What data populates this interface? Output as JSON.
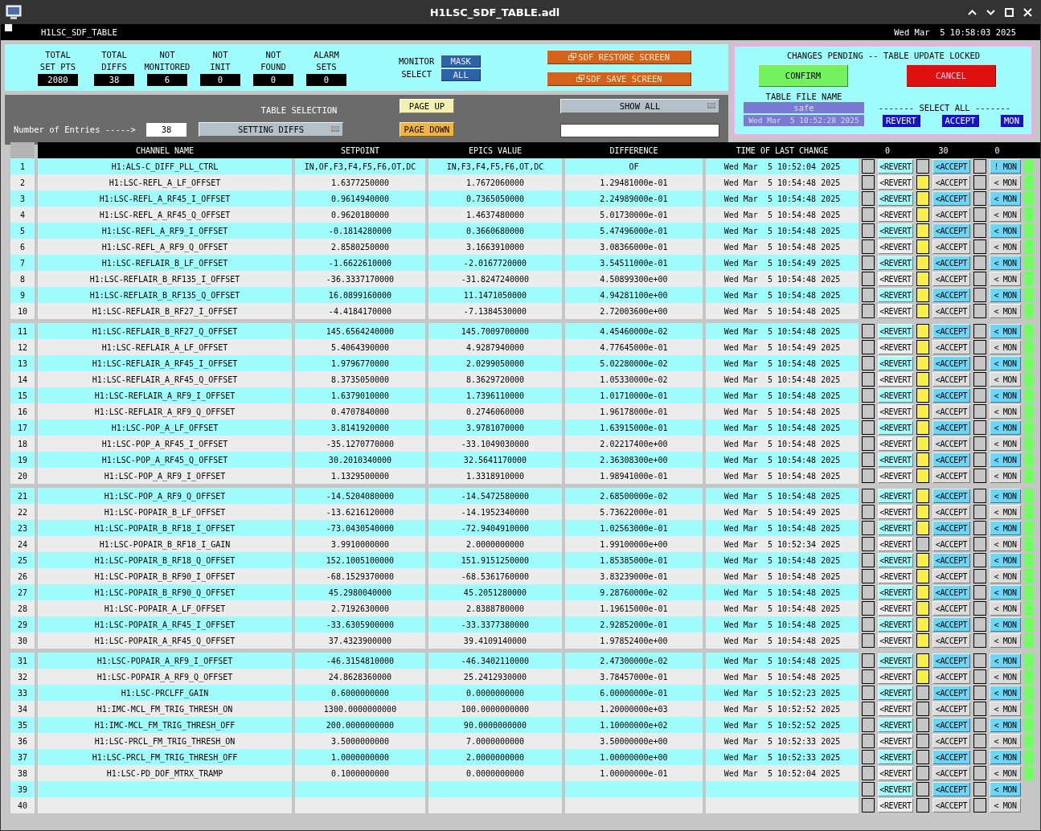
{
  "window": {
    "title": "H1LSC_SDF_TABLE.adl"
  },
  "banner": {
    "name": "H1LSC_SDF_TABLE",
    "datetime": "Wed Mar  5 10:58:03 2025"
  },
  "stats": [
    {
      "label": [
        "TOTAL",
        "SET PTS"
      ],
      "value": "2080"
    },
    {
      "label": [
        "TOTAL",
        "DIFFS"
      ],
      "value": "38"
    },
    {
      "label": [
        "NOT",
        "MONITORED"
      ],
      "value": "6"
    },
    {
      "label": [
        "NOT",
        "INIT"
      ],
      "value": "0"
    },
    {
      "label": [
        "NOT",
        "FOUND"
      ],
      "value": "0"
    },
    {
      "label": [
        "ALARM",
        "SETS"
      ],
      "value": "0"
    }
  ],
  "monitor_select": {
    "label": [
      "MONITOR",
      "SELECT"
    ],
    "options": [
      "MASK",
      "ALL"
    ]
  },
  "screen_buttons": [
    "SDF RESTORE SCREEN",
    "SDF SAVE SCREEN"
  ],
  "selection": {
    "entries_label": "Number of Entries ----->",
    "entries": "38",
    "table_selection_label": "TABLE SELECTION",
    "table_selection": "SETTING DIFFS",
    "page_up": "PAGE UP",
    "page_down": "PAGE DOWN",
    "filter": "SHOW ALL"
  },
  "pending": {
    "message": "CHANGES PENDING -- TABLE UPDATE LOCKED",
    "confirm": "CONFIRM",
    "cancel": "CANCEL",
    "file_label": "TABLE FILE NAME",
    "file_name": "safe",
    "file_time": "Wed Mar  5 10:52:28 2025",
    "select_all_label": "------- SELECT ALL -------",
    "select_all": [
      "REVERT",
      "ACCEPT",
      "MON"
    ]
  },
  "table": {
    "columns": [
      "CHANNEL NAME",
      "SETPOINT",
      "EPICS VALUE",
      "DIFFERENCE",
      "TIME OF LAST CHANGE",
      "0",
      "30",
      "0"
    ],
    "rows": [
      {
        "n": "1",
        "channel": "H1:ALS-C_DIFF_PLL_CTRL",
        "setpoint": "IN,OF,F3,F4,F5,F6,OT,DC",
        "epics": "IN,F3,F4,F5,F6,OT,DC",
        "diff": "OF",
        "time": "Wed Mar  5 10:52:04 2025",
        "revert": false,
        "revert_label": "<REVERT",
        "accept": false,
        "accept_label": "<ACCEPT",
        "mon": false,
        "mon_label": "! MON",
        "indicator": true
      },
      {
        "n": "2",
        "channel": "H1:LSC-REFL_A_LF_OFFSET",
        "setpoint": "1.6377250000",
        "epics": "1.7672060000",
        "diff": "1.29481000e-01",
        "time": "Wed Mar  5 10:54:48 2025",
        "revert": false,
        "revert_label": "<REVERT",
        "accept": true,
        "accept_label": "<ACCEPT",
        "mon": false,
        "mon_label": "< MON",
        "indicator": true
      },
      {
        "n": "3",
        "channel": "H1:LSC-REFL_A_RF45_I_OFFSET",
        "setpoint": "0.9614940000",
        "epics": "0.7365050000",
        "diff": "2.24989000e-01",
        "time": "Wed Mar  5 10:54:48 2025",
        "revert": false,
        "revert_label": "<REVERT",
        "accept": true,
        "accept_label": "<ACCEPT",
        "mon": false,
        "mon_label": "< MON",
        "indicator": true
      },
      {
        "n": "4",
        "channel": "H1:LSC-REFL_A_RF45_Q_OFFSET",
        "setpoint": "0.9620180000",
        "epics": "1.4637480000",
        "diff": "5.01730000e-01",
        "time": "Wed Mar  5 10:54:48 2025",
        "revert": false,
        "revert_label": "<REVERT",
        "accept": true,
        "accept_label": "<ACCEPT",
        "mon": false,
        "mon_label": "< MON",
        "indicator": true
      },
      {
        "n": "5",
        "channel": "H1:LSC-REFL_A_RF9_I_OFFSET",
        "setpoint": "-0.1814280000",
        "epics": "0.3660680000",
        "diff": "5.47496000e-01",
        "time": "Wed Mar  5 10:54:48 2025",
        "revert": false,
        "revert_label": "<REVERT",
        "accept": true,
        "accept_label": "<ACCEPT",
        "mon": false,
        "mon_label": "< MON",
        "indicator": true
      },
      {
        "n": "6",
        "channel": "H1:LSC-REFL_A_RF9_Q_OFFSET",
        "setpoint": "2.8580250000",
        "epics": "3.1663910000",
        "diff": "3.08366000e-01",
        "time": "Wed Mar  5 10:54:48 2025",
        "revert": false,
        "revert_label": "<REVERT",
        "accept": true,
        "accept_label": "<ACCEPT",
        "mon": false,
        "mon_label": "< MON",
        "indicator": true
      },
      {
        "n": "7",
        "channel": "H1:LSC-REFLAIR_B_LF_OFFSET",
        "setpoint": "-1.6622610000",
        "epics": "-2.0167720000",
        "diff": "3.54511000e-01",
        "time": "Wed Mar  5 10:54:49 2025",
        "revert": false,
        "revert_label": "<REVERT",
        "accept": true,
        "accept_label": "<ACCEPT",
        "mon": false,
        "mon_label": "< MON",
        "indicator": true
      },
      {
        "n": "8",
        "channel": "H1:LSC-REFLAIR_B_RF135_I_OFFSET",
        "setpoint": "-36.3337170000",
        "epics": "-31.8247240000",
        "diff": "4.50899300e+00",
        "time": "Wed Mar  5 10:54:48 2025",
        "revert": false,
        "revert_label": "<REVERT",
        "accept": true,
        "accept_label": "<ACCEPT",
        "mon": false,
        "mon_label": "< MON",
        "indicator": true
      },
      {
        "n": "9",
        "channel": "H1:LSC-REFLAIR_B_RF135_Q_OFFSET",
        "setpoint": "16.0899160000",
        "epics": "11.1471050000",
        "diff": "4.94281100e+00",
        "time": "Wed Mar  5 10:54:48 2025",
        "revert": false,
        "revert_label": "<REVERT",
        "accept": true,
        "accept_label": "<ACCEPT",
        "mon": false,
        "mon_label": "< MON",
        "indicator": true
      },
      {
        "n": "10",
        "channel": "H1:LSC-REFLAIR_B_RF27_I_OFFSET",
        "setpoint": "-4.4184170000",
        "epics": "-7.1384530000",
        "diff": "2.72003600e+00",
        "time": "Wed Mar  5 10:54:48 2025",
        "revert": false,
        "revert_label": "<REVERT",
        "accept": true,
        "accept_label": "<ACCEPT",
        "mon": false,
        "mon_label": "< MON",
        "indicator": true
      },
      {
        "n": "11",
        "channel": "H1:LSC-REFLAIR_B_RF27_Q_OFFSET",
        "setpoint": "145.6564240000",
        "epics": "145.7009700000",
        "diff": "4.45460000e-02",
        "time": "Wed Mar  5 10:54:48 2025",
        "revert": false,
        "revert_label": "<REVERT",
        "accept": true,
        "accept_label": "<ACCEPT",
        "mon": false,
        "mon_label": "< MON",
        "indicator": true
      },
      {
        "n": "12",
        "channel": "H1:LSC-REFLAIR_A_LF_OFFSET",
        "setpoint": "5.4064390000",
        "epics": "4.9287940000",
        "diff": "4.77645000e-01",
        "time": "Wed Mar  5 10:54:49 2025",
        "revert": false,
        "revert_label": "<REVERT",
        "accept": true,
        "accept_label": "<ACCEPT",
        "mon": false,
        "mon_label": "< MON",
        "indicator": true
      },
      {
        "n": "13",
        "channel": "H1:LSC-REFLAIR_A_RF45_I_OFFSET",
        "setpoint": "1.9796770000",
        "epics": "2.0299050000",
        "diff": "5.02280000e-02",
        "time": "Wed Mar  5 10:54:48 2025",
        "revert": false,
        "revert_label": "<REVERT",
        "accept": true,
        "accept_label": "<ACCEPT",
        "mon": false,
        "mon_label": "< MON",
        "indicator": true
      },
      {
        "n": "14",
        "channel": "H1:LSC-REFLAIR_A_RF45_Q_OFFSET",
        "setpoint": "8.3735050000",
        "epics": "8.3629720000",
        "diff": "1.05330000e-02",
        "time": "Wed Mar  5 10:54:48 2025",
        "revert": false,
        "revert_label": "<REVERT",
        "accept": true,
        "accept_label": "<ACCEPT",
        "mon": false,
        "mon_label": "< MON",
        "indicator": true
      },
      {
        "n": "15",
        "channel": "H1:LSC-REFLAIR_A_RF9_I_OFFSET",
        "setpoint": "1.6379010000",
        "epics": "1.7396110000",
        "diff": "1.01710000e-01",
        "time": "Wed Mar  5 10:54:48 2025",
        "revert": false,
        "revert_label": "<REVERT",
        "accept": true,
        "accept_label": "<ACCEPT",
        "mon": false,
        "mon_label": "< MON",
        "indicator": true
      },
      {
        "n": "16",
        "channel": "H1:LSC-REFLAIR_A_RF9_Q_OFFSET",
        "setpoint": "0.4707840000",
        "epics": "0.2746060000",
        "diff": "1.96178000e-01",
        "time": "Wed Mar  5 10:54:48 2025",
        "revert": false,
        "revert_label": "<REVERT",
        "accept": true,
        "accept_label": "<ACCEPT",
        "mon": false,
        "mon_label": "< MON",
        "indicator": true
      },
      {
        "n": "17",
        "channel": "H1:LSC-POP_A_LF_OFFSET",
        "setpoint": "3.8141920000",
        "epics": "3.9781070000",
        "diff": "1.63915000e-01",
        "time": "Wed Mar  5 10:54:48 2025",
        "revert": false,
        "revert_label": "<REVERT",
        "accept": true,
        "accept_label": "<ACCEPT",
        "mon": false,
        "mon_label": "< MON",
        "indicator": true
      },
      {
        "n": "18",
        "channel": "H1:LSC-POP_A_RF45_I_OFFSET",
        "setpoint": "-35.1270770000",
        "epics": "-33.1049030000",
        "diff": "2.02217400e+00",
        "time": "Wed Mar  5 10:54:48 2025",
        "revert": false,
        "revert_label": "<REVERT",
        "accept": true,
        "accept_label": "<ACCEPT",
        "mon": false,
        "mon_label": "< MON",
        "indicator": true
      },
      {
        "n": "19",
        "channel": "H1:LSC-POP_A_RF45_Q_OFFSET",
        "setpoint": "30.2010340000",
        "epics": "32.5641170000",
        "diff": "2.36308300e+00",
        "time": "Wed Mar  5 10:54:48 2025",
        "revert": false,
        "revert_label": "<REVERT",
        "accept": true,
        "accept_label": "<ACCEPT",
        "mon": false,
        "mon_label": "< MON",
        "indicator": true
      },
      {
        "n": "20",
        "channel": "H1:LSC-POP_A_RF9_I_OFFSET",
        "setpoint": "1.1329500000",
        "epics": "1.3318910000",
        "diff": "1.98941000e-01",
        "time": "Wed Mar  5 10:54:48 2025",
        "revert": false,
        "revert_label": "<REVERT",
        "accept": true,
        "accept_label": "<ACCEPT",
        "mon": false,
        "mon_label": "< MON",
        "indicator": true
      },
      {
        "n": "21",
        "channel": "H1:LSC-POP_A_RF9_Q_OFFSET",
        "setpoint": "-14.5204080000",
        "epics": "-14.5472580000",
        "diff": "2.68500000e-02",
        "time": "Wed Mar  5 10:54:48 2025",
        "revert": false,
        "revert_label": "<REVERT",
        "accept": true,
        "accept_label": "<ACCEPT",
        "mon": false,
        "mon_label": "< MON",
        "indicator": true
      },
      {
        "n": "22",
        "channel": "H1:LSC-POPAIR_B_LF_OFFSET",
        "setpoint": "-13.6216120000",
        "epics": "-14.1952340000",
        "diff": "5.73622000e-01",
        "time": "Wed Mar  5 10:54:49 2025",
        "revert": false,
        "revert_label": "<REVERT",
        "accept": true,
        "accept_label": "<ACCEPT",
        "mon": false,
        "mon_label": "< MON",
        "indicator": true
      },
      {
        "n": "23",
        "channel": "H1:LSC-POPAIR_B_RF18_I_OFFSET",
        "setpoint": "-73.0430540000",
        "epics": "-72.9404910000",
        "diff": "1.02563000e-01",
        "time": "Wed Mar  5 10:54:48 2025",
        "revert": false,
        "revert_label": "<REVERT",
        "accept": true,
        "accept_label": "<ACCEPT",
        "mon": false,
        "mon_label": "< MON",
        "indicator": true
      },
      {
        "n": "24",
        "channel": "H1:LSC-POPAIR_B_RF18_I_GAIN",
        "setpoint": "3.9910000000",
        "epics": "2.0000000000",
        "diff": "1.99100000e+00",
        "time": "Wed Mar  5 10:52:34 2025",
        "revert": false,
        "revert_label": "<REVERT",
        "accept": false,
        "accept_label": "<ACCEPT",
        "mon": false,
        "mon_label": "< MON",
        "indicator": true
      },
      {
        "n": "25",
        "channel": "H1:LSC-POPAIR_B_RF18_Q_OFFSET",
        "setpoint": "152.1005100000",
        "epics": "151.9151250000",
        "diff": "1.85385000e-01",
        "time": "Wed Mar  5 10:54:48 2025",
        "revert": false,
        "revert_label": "<REVERT",
        "accept": true,
        "accept_label": "<ACCEPT",
        "mon": false,
        "mon_label": "< MON",
        "indicator": true
      },
      {
        "n": "26",
        "channel": "H1:LSC-POPAIR_B_RF90_I_OFFSET",
        "setpoint": "-68.1529370000",
        "epics": "-68.5361760000",
        "diff": "3.83239000e-01",
        "time": "Wed Mar  5 10:54:48 2025",
        "revert": false,
        "revert_label": "<REVERT",
        "accept": true,
        "accept_label": "<ACCEPT",
        "mon": false,
        "mon_label": "< MON",
        "indicator": true
      },
      {
        "n": "27",
        "channel": "H1:LSC-POPAIR_B_RF90_Q_OFFSET",
        "setpoint": "45.2980040000",
        "epics": "45.2051280000",
        "diff": "9.28760000e-02",
        "time": "Wed Mar  5 10:54:48 2025",
        "revert": false,
        "revert_label": "<REVERT",
        "accept": true,
        "accept_label": "<ACCEPT",
        "mon": false,
        "mon_label": "< MON",
        "indicator": true
      },
      {
        "n": "28",
        "channel": "H1:LSC-POPAIR_A_LF_OFFSET",
        "setpoint": "2.7192630000",
        "epics": "2.8388780000",
        "diff": "1.19615000e-01",
        "time": "Wed Mar  5 10:54:48 2025",
        "revert": false,
        "revert_label": "<REVERT",
        "accept": true,
        "accept_label": "<ACCEPT",
        "mon": false,
        "mon_label": "< MON",
        "indicator": true
      },
      {
        "n": "29",
        "channel": "H1:LSC-POPAIR_A_RF45_I_OFFSET",
        "setpoint": "-33.6305900000",
        "epics": "-33.3377380000",
        "diff": "2.92852000e-01",
        "time": "Wed Mar  5 10:54:48 2025",
        "revert": false,
        "revert_label": "<REVERT",
        "accept": true,
        "accept_label": "<ACCEPT",
        "mon": false,
        "mon_label": "< MON",
        "indicator": true
      },
      {
        "n": "30",
        "channel": "H1:LSC-POPAIR_A_RF45_Q_OFFSET",
        "setpoint": "37.4323900000",
        "epics": "39.4109140000",
        "diff": "1.97852400e+00",
        "time": "Wed Mar  5 10:54:48 2025",
        "revert": false,
        "revert_label": "<REVERT",
        "accept": true,
        "accept_label": "<ACCEPT",
        "mon": false,
        "mon_label": "< MON",
        "indicator": true
      },
      {
        "n": "31",
        "channel": "H1:LSC-POPAIR_A_RF9_I_OFFSET",
        "setpoint": "-46.3154810000",
        "epics": "-46.3402110000",
        "diff": "2.47300000e-02",
        "time": "Wed Mar  5 10:54:48 2025",
        "revert": false,
        "revert_label": "<REVERT",
        "accept": true,
        "accept_label": "<ACCEPT",
        "mon": false,
        "mon_label": "< MON",
        "indicator": true
      },
      {
        "n": "32",
        "channel": "H1:LSC-POPAIR_A_RF9_Q_OFFSET",
        "setpoint": "24.8628360000",
        "epics": "25.2412930000",
        "diff": "3.78457000e-01",
        "time": "Wed Mar  5 10:54:48 2025",
        "revert": false,
        "revert_label": "<REVERT",
        "accept": true,
        "accept_label": "<ACCEPT",
        "mon": false,
        "mon_label": "< MON",
        "indicator": true
      },
      {
        "n": "33",
        "channel": "H1:LSC-PRCLFF_GAIN",
        "setpoint": "0.6000000000",
        "epics": "0.0000000000",
        "diff": "6.00000000e-01",
        "time": "Wed Mar  5 10:52:23 2025",
        "revert": false,
        "revert_label": "<REVERT",
        "accept": false,
        "accept_label": "<ACCEPT",
        "mon": false,
        "mon_label": "< MON",
        "indicator": true
      },
      {
        "n": "34",
        "channel": "H1:IMC-MCL_FM_TRIG_THRESH_ON",
        "setpoint": "1300.0000000000",
        "epics": "100.0000000000",
        "diff": "1.20000000e+03",
        "time": "Wed Mar  5 10:52:52 2025",
        "revert": false,
        "revert_label": "<REVERT",
        "accept": false,
        "accept_label": "<ACCEPT",
        "mon": false,
        "mon_label": "< MON",
        "indicator": true
      },
      {
        "n": "35",
        "channel": "H1:IMC-MCL_FM_TRIG_THRESH_OFF",
        "setpoint": "200.0000000000",
        "epics": "90.0000000000",
        "diff": "1.10000000e+02",
        "time": "Wed Mar  5 10:52:52 2025",
        "revert": false,
        "revert_label": "<REVERT",
        "accept": false,
        "accept_label": "<ACCEPT",
        "mon": false,
        "mon_label": "< MON",
        "indicator": true
      },
      {
        "n": "36",
        "channel": "H1:LSC-PRCL_FM_TRIG_THRESH_ON",
        "setpoint": "3.5000000000",
        "epics": "7.0000000000",
        "diff": "3.50000000e+00",
        "time": "Wed Mar  5 10:52:33 2025",
        "revert": false,
        "revert_label": "<REVERT",
        "accept": false,
        "accept_label": "<ACCEPT",
        "mon": false,
        "mon_label": "< MON",
        "indicator": true
      },
      {
        "n": "37",
        "channel": "H1:LSC-PRCL_FM_TRIG_THRESH_OFF",
        "setpoint": "1.0000000000",
        "epics": "2.0000000000",
        "diff": "1.00000000e+00",
        "time": "Wed Mar  5 10:52:33 2025",
        "revert": false,
        "revert_label": "<REVERT",
        "accept": false,
        "accept_label": "<ACCEPT",
        "mon": false,
        "mon_label": "< MON",
        "indicator": true
      },
      {
        "n": "38",
        "channel": "H1:LSC-PD_DOF_MTRX_TRAMP",
        "setpoint": "0.1000000000",
        "epics": "0.0000000000",
        "diff": "1.00000000e-01",
        "time": "Wed Mar  5 10:52:04 2025",
        "revert": false,
        "revert_label": "<REVERT",
        "accept": false,
        "accept_label": "<ACCEPT",
        "mon": false,
        "mon_label": "< MON",
        "indicator": true
      },
      {
        "n": "39",
        "revert": false,
        "revert_label": "<REVERT",
        "accept": false,
        "accept_label": "<ACCEPT",
        "mon": false,
        "mon_label": "< MON",
        "indicator": false
      },
      {
        "n": "40",
        "revert": false,
        "revert_label": "<REVERT",
        "accept": false,
        "accept_label": "<ACCEPT",
        "mon": false,
        "mon_label": "< MON",
        "indicator": false
      }
    ]
  }
}
